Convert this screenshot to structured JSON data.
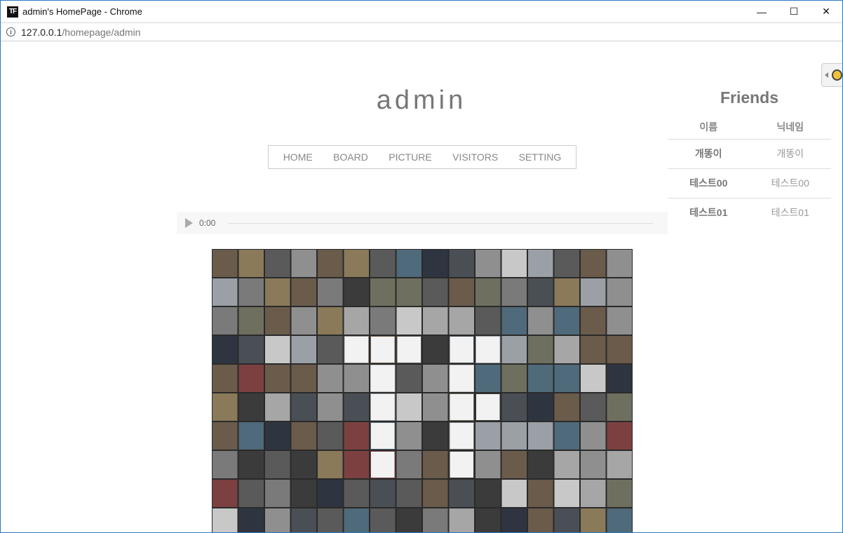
{
  "window": {
    "icon_text": "TF",
    "title": "admin's HomePage - Chrome",
    "controls": {
      "minimize": "—",
      "maximize": "☐",
      "close": "✕"
    }
  },
  "address_bar": {
    "host": "127.0.0.1",
    "path": "/homepage/admin"
  },
  "page": {
    "title": "admin",
    "nav": [
      "HOME",
      "BOARD",
      "PICTURE",
      "VISITORS",
      "SETTING"
    ],
    "audio": {
      "time": "0:00",
      "progress": 0
    }
  },
  "friends": {
    "title": "Friends",
    "headers": {
      "name": "이름",
      "nickname": "닉네임"
    },
    "rows": [
      {
        "name": "개똥이",
        "nickname": "개똥이"
      },
      {
        "name": "테스트00",
        "nickname": "테스트00"
      },
      {
        "name": "테스트01",
        "nickname": "테스트01"
      }
    ]
  },
  "colors": {
    "window_border": "#2b7bbf",
    "text_gray": "#777777",
    "nav_border": "#cccccc"
  }
}
